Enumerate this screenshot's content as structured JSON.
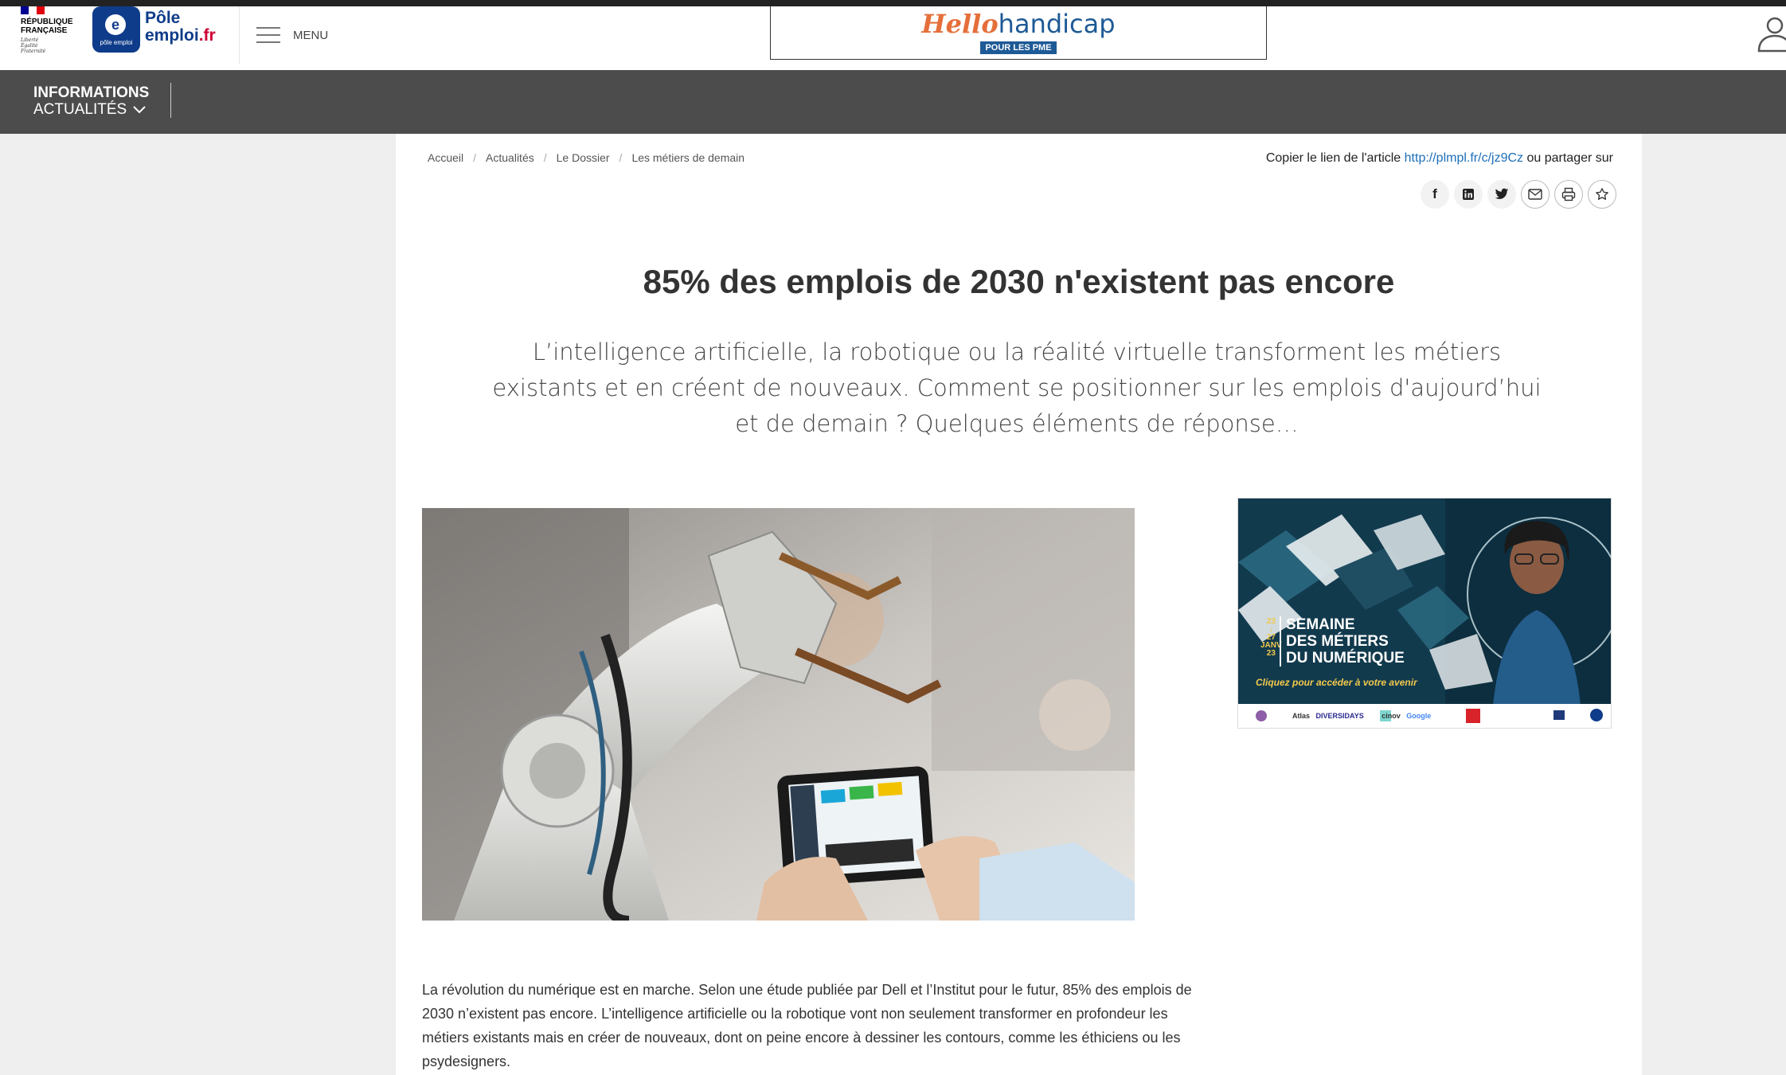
{
  "header": {
    "republique_lines": [
      "RÉPUBLIQUE",
      "FRANÇAISE"
    ],
    "motto_lines": [
      "Liberté",
      "Égalité",
      "Fraternité"
    ],
    "logo_small": "pôle emploi",
    "logo_name_line1": "Pôle",
    "logo_name_line2a": "emploi",
    "logo_name_line2b": ".fr",
    "menu_label": "MENU",
    "banner_hello": "Hello",
    "banner_handicap": "handicap",
    "banner_pme": "POUR LES PME",
    "icons": {
      "menu": "hamburger-icon",
      "user": "user-icon"
    },
    "colors": {
      "brand_blue": "#0f3c8a",
      "brand_red": "#c03",
      "nav_bg": "#4c4c4c"
    }
  },
  "nav": {
    "item_line1": "INFORMATIONS",
    "item_line2": "ACTUALITÉS",
    "chevron": "chevron-down-icon"
  },
  "breadcrumb": [
    "Accueil",
    "Actualités",
    "Le Dossier",
    "Les métiers de demain"
  ],
  "share": {
    "prefix": "Copier le lien de l'article",
    "link": "http://plmpl.fr/c/jz9Cz",
    "suffix": "ou partager sur",
    "icons": [
      "facebook-icon",
      "linkedin-icon",
      "twitter-icon",
      "email-icon",
      "print-icon",
      "favorite-star-icon"
    ]
  },
  "article": {
    "title": "85% des emplois de 2030 n'existent pas encore",
    "lead": "L’intelligence artificielle, la robotique ou la réalité virtuelle transforment les métiers existants et en créent de nouveaux. Comment se positionner sur les emplois d'aujourd’hui et de demain ? Quelques éléments de réponse…",
    "body": "La révolution du numérique est en marche. Selon une étude publiée par Dell et l’Institut pour le futur, 85% des emplois de 2030 n’existent pas encore. L’intelligence artificielle ou la robotique vont non seulement transformer en profondeur les métiers existants mais en créer de nouveaux, dont on peine encore à dessiner les contours, comme les éthiciens ou les psydesigners."
  },
  "side_ad": {
    "dates": [
      "23",
      "↓",
      "27",
      "JANV",
      "23"
    ],
    "line1": "SEMAINE",
    "line2": "DES MÉTIERS",
    "line3": "DU NUMÉRIQUE",
    "cta": "Cliquez pour accéder à votre avenir",
    "partners": [
      "Atlas",
      "DIVERSIDAYS",
      "cinov",
      "Google"
    ]
  }
}
